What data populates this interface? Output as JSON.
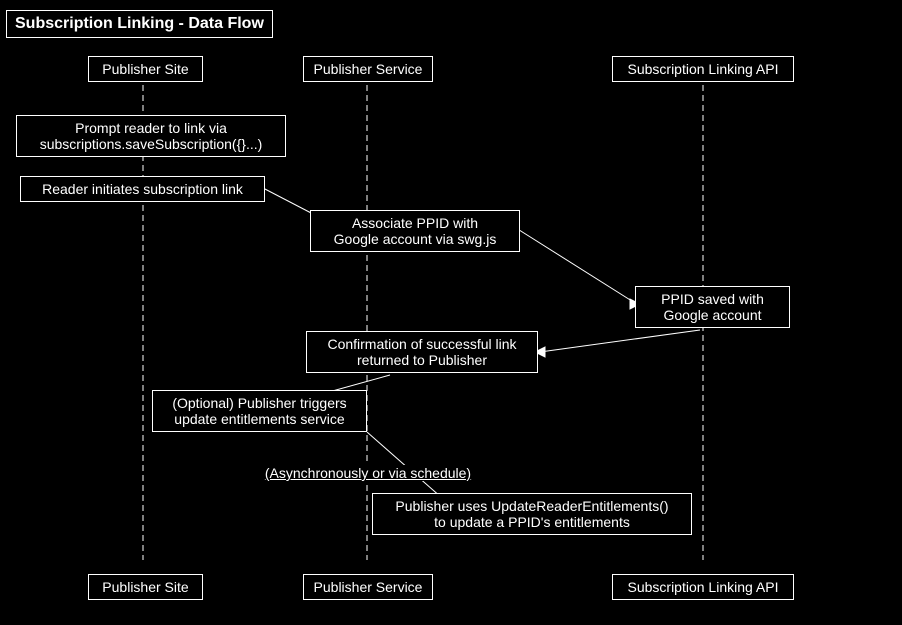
{
  "title": "Subscription Linking - Data Flow",
  "columns": {
    "publisher_site": "Publisher Site",
    "publisher_service": "Publisher Service",
    "subscription_linking_api": "Subscription Linking API"
  },
  "nodes": {
    "prompt_reader": "Prompt reader to link via\nsubscriptions.saveSubscription({}...)",
    "reader_initiates": "Reader initiates subscription link",
    "associate_ppid": "Associate PPID with\nGoogle account via swg.js",
    "ppid_saved": "PPID saved with\nGoogle account",
    "confirmation": "Confirmation of successful link\nreturned to Publisher",
    "optional_publisher": "(Optional) Publisher triggers\nupdate entitlements service",
    "asynchronously": "(Asynchronously or via schedule)",
    "publisher_uses": "Publisher uses UpdateReaderEntitlements()\nto update a PPID's entitlements"
  },
  "footer": {
    "publisher_site": "Publisher Site",
    "publisher_service": "Publisher Service",
    "subscription_linking_api": "Subscription Linking API"
  }
}
